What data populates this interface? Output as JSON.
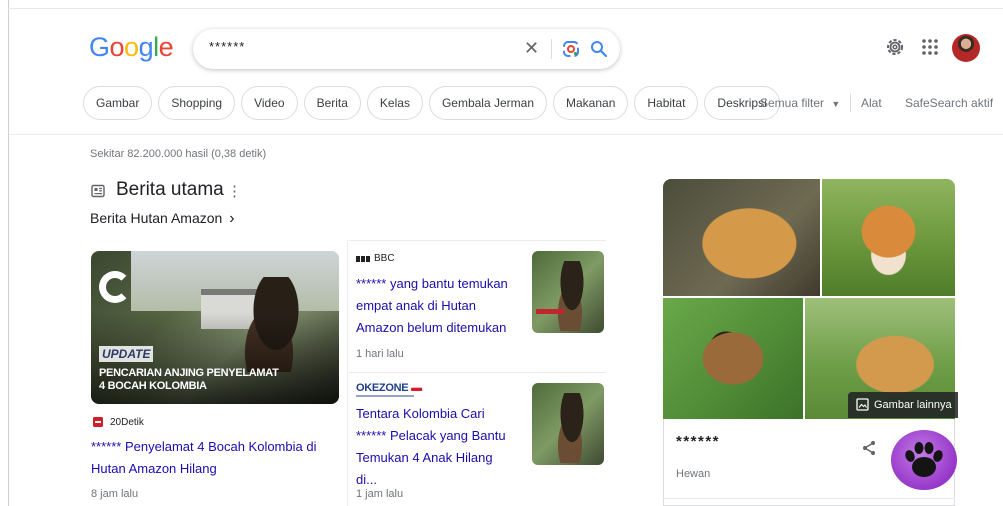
{
  "logo": {
    "letters": [
      {
        "char": "G",
        "color": "#4285F4"
      },
      {
        "char": "o",
        "color": "#EA4335"
      },
      {
        "char": "o",
        "color": "#FBBC05"
      },
      {
        "char": "g",
        "color": "#4285F4"
      },
      {
        "char": "l",
        "color": "#34A853"
      },
      {
        "char": "e",
        "color": "#EA4335"
      }
    ]
  },
  "search": {
    "query": "******",
    "icons": [
      "close-icon",
      "google-lens-icon",
      "search-icon"
    ]
  },
  "header_icons": [
    "gear-icon",
    "apps-grid-icon",
    "avatar"
  ],
  "chips": [
    "Gambar",
    "Shopping",
    "Video",
    "Berita",
    "Kelas",
    "Gembala Jerman",
    "Makanan",
    "Habitat",
    "Deskripsi"
  ],
  "filters": {
    "all_filters": "Semua filter",
    "tools": "Alat",
    "safesearch": "SafeSearch aktif"
  },
  "result_stats": "Sekitar 82.200.000 hasil (0,38 detik)",
  "top_stories": {
    "title": "Berita utama",
    "subtitle": "Berita Hutan Amazon",
    "subtitle_chevron": "›",
    "main": {
      "thumb_update": "UPDATE",
      "thumb_headline_1": "PENCARIAN ANJING PENYELAMAT",
      "thumb_headline_2": "4 BOCAH KOLOMBIA",
      "source": "20Detik",
      "title": "****** Penyelamat 4 Bocah Kolombia di Hutan Amazon Hilang",
      "time": "8 jam lalu"
    },
    "side": [
      {
        "source": "BBC",
        "title": "****** yang bantu temukan empat anak di Hutan Amazon belum ditemukan",
        "time": "1 hari lalu"
      },
      {
        "source_logo_text": "OKEZONE",
        "title": "Tentara Kolombia Cari ****** Pelacak yang Bantu Temukan 4 Anak Hilang di...",
        "time": "1 jam lalu"
      }
    ]
  },
  "knowledge_panel": {
    "title": "******",
    "subtitle": "Hewan",
    "more_images": "Gambar lainnya",
    "badge_icon": "paw-icon"
  }
}
